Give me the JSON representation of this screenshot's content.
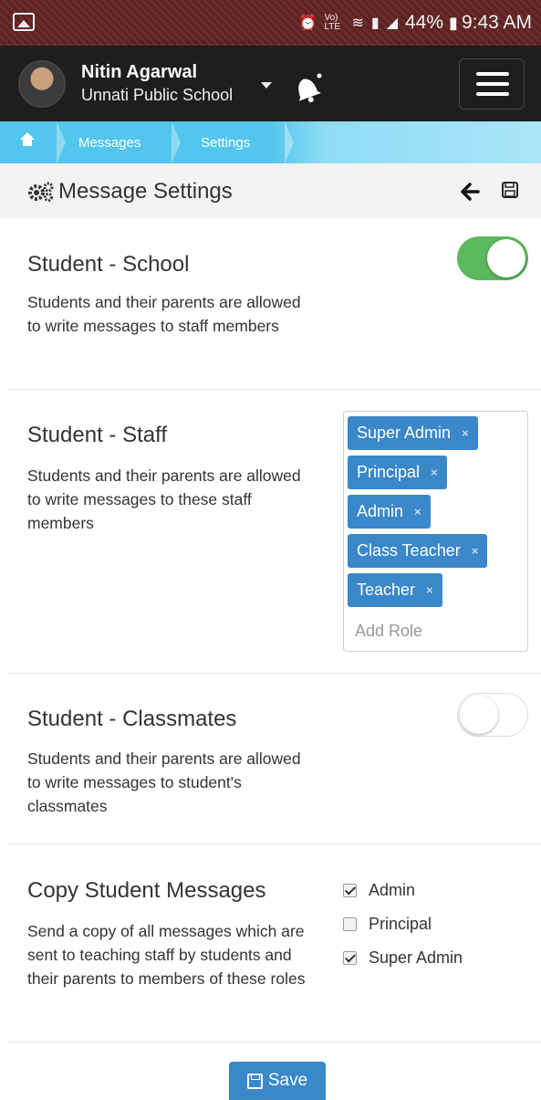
{
  "status_bar": {
    "icons": [
      "gallery-icon",
      "alarm-icon",
      "volte-icon",
      "wifi-icon",
      "sim-icon",
      "signal-icon"
    ],
    "volte_text": "Vo) LTE",
    "battery": "44%",
    "time": "9:43 AM"
  },
  "header": {
    "user_name": "Nitin Agarwal",
    "school": "Unnati Public School",
    "notification_icon": "bell-icon",
    "menu_icon": "hamburger-icon"
  },
  "breadcrumb": {
    "home_icon": "home-icon",
    "items": [
      "Messages",
      "Settings"
    ]
  },
  "page": {
    "title": "Message Settings",
    "title_icon": "gears-icon",
    "back_icon": "arrow-left-icon",
    "save_icon": "floppy-icon"
  },
  "sections": {
    "student_school": {
      "title": "Student - School",
      "description": "Students and their parents are allowed to write messages to staff members",
      "enabled": true
    },
    "student_staff": {
      "title": "Student - Staff",
      "description": "Students and their parents are allowed to write messages to these staff members",
      "roles": [
        "Super Admin",
        "Principal",
        "Admin",
        "Class Teacher",
        "Teacher"
      ],
      "remove_glyph": "×",
      "add_placeholder": "Add Role"
    },
    "student_classmates": {
      "title": "Student - Classmates",
      "description": "Students and their parents are allowed to write messages to student's classmates",
      "enabled": false
    },
    "copy_messages": {
      "title": "Copy Student Messages",
      "description": "Send a copy of all messages which are sent to teaching staff by students and their parents to members of these roles",
      "options": [
        {
          "label": "Admin",
          "checked": true
        },
        {
          "label": "Principal",
          "checked": false
        },
        {
          "label": "Super Admin",
          "checked": true
        }
      ]
    }
  },
  "save_button": {
    "label": "Save"
  },
  "colors": {
    "header_bg": "#1e1e1e",
    "breadcrumb_bg": "#52c6ec",
    "toggle_on": "#5cb85c",
    "tag_bg": "#3a87c9",
    "save_bg": "#3a87c9"
  }
}
